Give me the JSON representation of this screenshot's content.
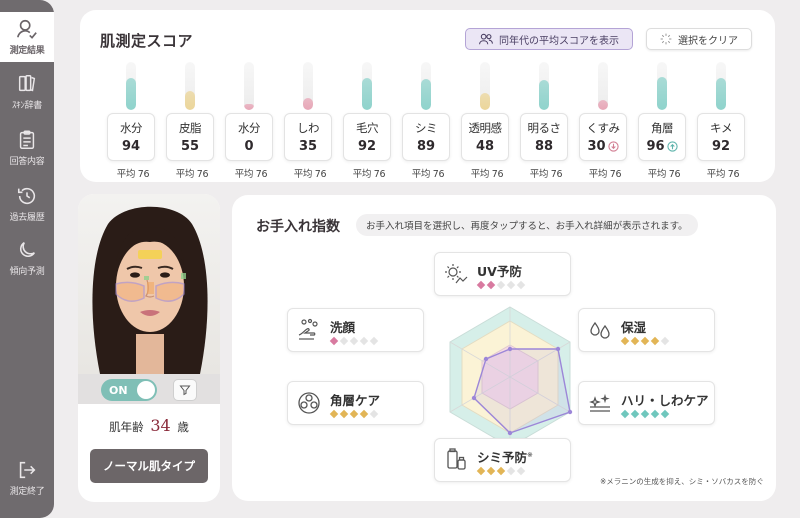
{
  "sidebar": {
    "items": [
      {
        "label": "測定結果",
        "icon": "user-check-icon",
        "active": true
      },
      {
        "label": "ｽｷﾝ辞書",
        "icon": "book-icon",
        "active": false
      },
      {
        "label": "回答内容",
        "icon": "clipboard-icon",
        "active": false
      },
      {
        "label": "過去履歴",
        "icon": "history-icon",
        "active": false
      },
      {
        "label": "傾向予測",
        "icon": "moon-icon",
        "active": false
      }
    ],
    "exit_label": "測定終了"
  },
  "score": {
    "title": "肌測定スコア",
    "avg_button_label": "同年代の平均スコアを表示",
    "clear_button_label": "選択をクリア",
    "metrics": [
      {
        "name": "水分",
        "value": "94",
        "avg": "平均 76",
        "color": "#8fd3cc"
      },
      {
        "name": "皮脂",
        "value": "55",
        "avg": "平均 76",
        "color": "#ecd69a"
      },
      {
        "name": "水分",
        "value": "0",
        "avg": "平均 76",
        "color": "#e8a6b7"
      },
      {
        "name": "しわ",
        "value": "35",
        "avg": "平均 76",
        "color": "#e8a6b7"
      },
      {
        "name": "毛穴",
        "value": "92",
        "avg": "平均 76",
        "color": "#8fd3cc"
      },
      {
        "name": "シミ",
        "value": "89",
        "avg": "平均 76",
        "color": "#8fd3cc"
      },
      {
        "name": "透明感",
        "value": "48",
        "avg": "平均 76",
        "color": "#ecd69a"
      },
      {
        "name": "明るさ",
        "value": "88",
        "avg": "平均 76",
        "color": "#8fd3cc"
      },
      {
        "name": "くすみ",
        "value": "30",
        "avg": "平均 76",
        "color": "#e8a6b7",
        "trend": "down"
      },
      {
        "name": "角層",
        "value": "96",
        "avg": "平均 76",
        "color": "#8fd3cc",
        "trend": "up"
      },
      {
        "name": "キメ",
        "value": "92",
        "avg": "平均 76",
        "color": "#8fd3cc"
      }
    ]
  },
  "face": {
    "toggle_label": "ON",
    "skin_age_prefix": "肌年齢",
    "skin_age_value": "34",
    "skin_age_suffix": "歳",
    "skin_type_label": "ノーマル肌タイプ"
  },
  "care": {
    "title": "お手入れ指数",
    "hint": "お手入れ項目を選択し、再度タップすると、お手入れ詳細が表示されます。",
    "items": [
      {
        "name": "UV予防",
        "icon": "sun-icon",
        "stars": 2,
        "star_color": "#d87aa0"
      },
      {
        "name": "保湿",
        "icon": "droplets-icon",
        "stars": 4,
        "star_color": "#e2b556"
      },
      {
        "name": "ハリ・しわケア",
        "icon": "sparkle-lines-icon",
        "stars": 5,
        "star_color": "#6fc7bd"
      },
      {
        "name": "シミ予防",
        "icon": "tube-icon",
        "stars": 3,
        "star_color": "#e2b556",
        "superscript": "※"
      },
      {
        "name": "角層ケア",
        "icon": "layers-circle-icon",
        "stars": 4,
        "star_color": "#e2b556"
      },
      {
        "name": "洗顔",
        "icon": "hand-wash-icon",
        "stars": 1,
        "star_color": "#d87aa0"
      }
    ],
    "footnote": "※メラニンの生成を抑え、シミ・ソバカスを防ぐ"
  },
  "colors": {
    "teal": "#8fd3cc",
    "yellow": "#ecd69a",
    "pink": "#e8a6b7",
    "purple": "#9c86d8"
  }
}
